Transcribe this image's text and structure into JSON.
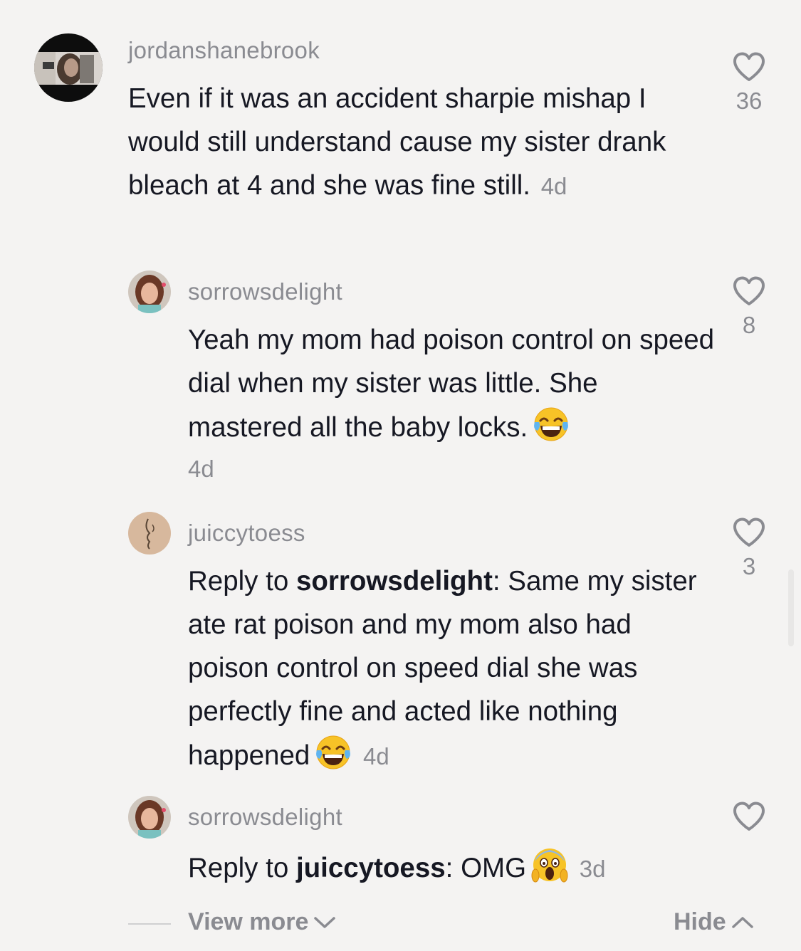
{
  "comments": [
    {
      "username": "jordanshanebrook",
      "text": "Even if it was an accident sharpie mishap I would still understand cause my sister drank bleach at 4 and she was fine still.",
      "time": "4d",
      "likes": "36"
    },
    {
      "username": "sorrowsdelight",
      "text": "Yeah my mom had poison control on speed dial when my sister was little. She mastered all the baby locks.",
      "emoji": "face-with-tears-of-joy",
      "time": "4d",
      "likes": "8"
    },
    {
      "username": "juiccytoess",
      "reply_prefix": "Reply to ",
      "reply_to": "sorrowsdelight",
      "reply_sep": ":",
      "text": "Same my sister ate rat poison and my mom also had poison control on speed dial she was perfectly fine and acted like nothing happened",
      "emoji": "face-with-tears-of-joy",
      "time": "4d",
      "likes": "3"
    },
    {
      "username": "sorrowsdelight",
      "reply_prefix": "Reply to ",
      "reply_to": "juiccytoess",
      "reply_sep": ":",
      "text": "OMG",
      "emoji": "face-screaming-in-fear",
      "time": "3d",
      "likes": ""
    }
  ],
  "footer": {
    "view_more": "View more",
    "hide": "Hide"
  },
  "colors": {
    "background": "#f4f3f2",
    "text": "#161823",
    "secondary": "#8a8b91"
  }
}
